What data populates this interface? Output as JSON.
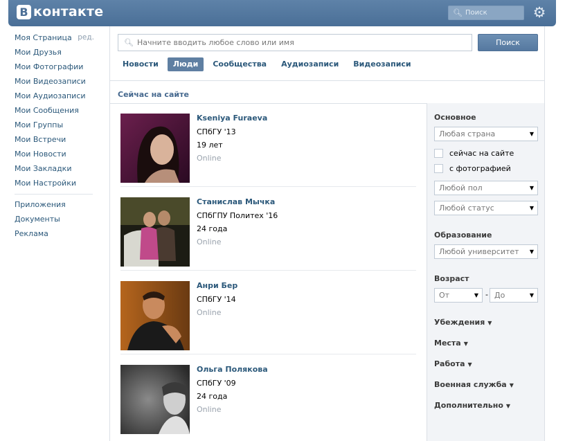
{
  "header": {
    "logo_letter": "B",
    "logo_text": "контакте",
    "search_placeholder": "Поиск",
    "search_icon": "search-icon",
    "settings_icon": "gear-icon"
  },
  "leftnav": {
    "items": [
      {
        "label": "Моя Страница",
        "edit": "ред."
      },
      {
        "label": "Мои Друзья"
      },
      {
        "label": "Мои Фотографии"
      },
      {
        "label": "Мои Видеозаписи"
      },
      {
        "label": "Мои Аудиозаписи"
      },
      {
        "label": "Мои Сообщения"
      },
      {
        "label": "Мои Группы"
      },
      {
        "label": "Мои Встречи"
      },
      {
        "label": "Мои Новости"
      },
      {
        "label": "Мои Закладки"
      },
      {
        "label": "Мои Настройки"
      }
    ],
    "extra": [
      {
        "label": "Приложения"
      },
      {
        "label": "Документы"
      },
      {
        "label": "Реклама"
      }
    ]
  },
  "search": {
    "placeholder": "Начните вводить любое слово или имя",
    "button": "Поиск"
  },
  "tabs": [
    {
      "label": "Новости"
    },
    {
      "label": "Люди",
      "active": true
    },
    {
      "label": "Сообщества"
    },
    {
      "label": "Аудиозаписи"
    },
    {
      "label": "Видеозаписи"
    }
  ],
  "section_title": "Сейчас на сайте",
  "results": [
    {
      "name": "Kseniya Furaeva",
      "line1": "СПбГУ '13",
      "line2": "19 лет",
      "status": "Online"
    },
    {
      "name": "Станислав Мычка",
      "line1": "СПбГПУ Политех '16",
      "line2": "24 года",
      "status": "Online"
    },
    {
      "name": "Анри Бер",
      "line1": "СПбГУ '14",
      "status": "Online"
    },
    {
      "name": "Ольга Полякова",
      "line1": "СПбГУ '09",
      "line2": "24 года",
      "status": "Online"
    }
  ],
  "filters": {
    "main_title": "Основное",
    "country": "Любая страна",
    "online_now": "сейчас на сайте",
    "with_photo": "с фотографией",
    "gender": "Любой пол",
    "status": "Любой статус",
    "education_title": "Образование",
    "university": "Любой университет",
    "age_title": "Возраст",
    "age_from": "От",
    "age_dash": "-",
    "age_to": "До",
    "expanders": [
      {
        "label": "Убеждения"
      },
      {
        "label": "Места"
      },
      {
        "label": "Работа"
      },
      {
        "label": "Военная служба"
      },
      {
        "label": "Дополнительно"
      }
    ]
  }
}
